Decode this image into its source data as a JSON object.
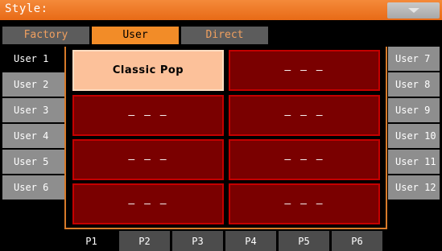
{
  "header": {
    "title": "Style:"
  },
  "tabs": [
    {
      "label": "Factory"
    },
    {
      "label": "User"
    },
    {
      "label": "Direct"
    }
  ],
  "left_banks": [
    {
      "label": "User 1"
    },
    {
      "label": "User 2"
    },
    {
      "label": "User 3"
    },
    {
      "label": "User 4"
    },
    {
      "label": "User 5"
    },
    {
      "label": "User 6"
    }
  ],
  "right_banks": [
    {
      "label": "User 7"
    },
    {
      "label": "User 8"
    },
    {
      "label": "User 9"
    },
    {
      "label": "User 10"
    },
    {
      "label": "User 11"
    },
    {
      "label": "User 12"
    }
  ],
  "slots": [
    {
      "label": "Classic Pop"
    },
    {
      "label": "— — —"
    },
    {
      "label": "— — —"
    },
    {
      "label": "— — —"
    },
    {
      "label": "— — —"
    },
    {
      "label": "— — —"
    },
    {
      "label": "— — —"
    },
    {
      "label": "— — —"
    }
  ],
  "pages": [
    {
      "label": "P1"
    },
    {
      "label": "P2"
    },
    {
      "label": "P3"
    },
    {
      "label": "P4"
    },
    {
      "label": "P5"
    },
    {
      "label": "P6"
    }
  ],
  "colors": {
    "accent": "#f28c28",
    "slot": "#7a0000",
    "selected_slot": "#fcc19a"
  }
}
